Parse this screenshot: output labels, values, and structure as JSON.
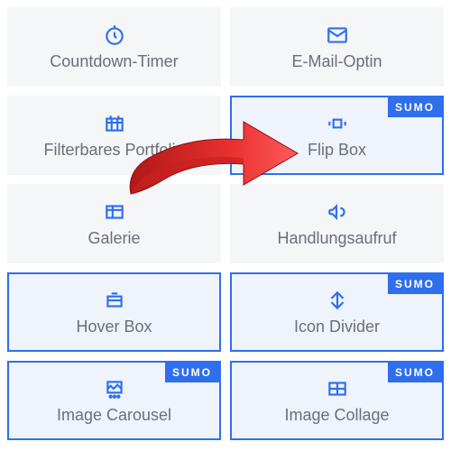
{
  "badge_label": "SUMO",
  "cards": [
    {
      "label": "Countdown-Timer",
      "icon": "clock-icon",
      "bordered": false,
      "badge": false
    },
    {
      "label": "E-Mail-Optin",
      "icon": "mail-icon",
      "bordered": false,
      "badge": false
    },
    {
      "label": "Filterbares Portfolio",
      "icon": "grid-icon",
      "bordered": false,
      "badge": false
    },
    {
      "label": "Flip Box",
      "icon": "flip-icon",
      "bordered": true,
      "badge": true
    },
    {
      "label": "Galerie",
      "icon": "gallery-icon",
      "bordered": false,
      "badge": false
    },
    {
      "label": "Handlungsaufruf",
      "icon": "megaphone-icon",
      "bordered": false,
      "badge": false
    },
    {
      "label": "Hover Box",
      "icon": "hover-icon",
      "bordered": true,
      "badge": false
    },
    {
      "label": "Icon Divider",
      "icon": "divider-icon",
      "bordered": true,
      "badge": true
    },
    {
      "label": "Image Carousel",
      "icon": "carousel-icon",
      "bordered": true,
      "badge": true
    },
    {
      "label": "Image Collage",
      "icon": "collage-icon",
      "bordered": true,
      "badge": true
    }
  ]
}
